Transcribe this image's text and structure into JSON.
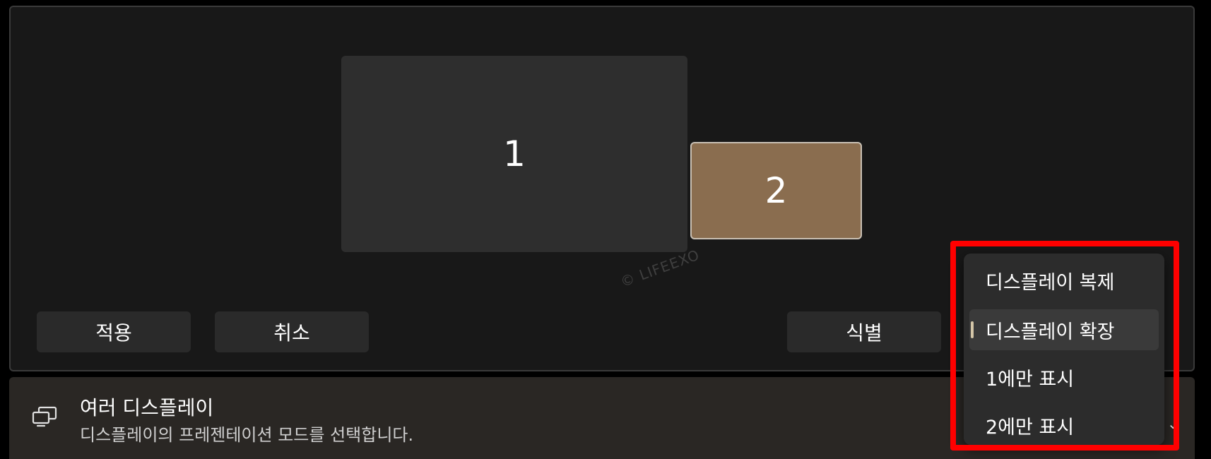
{
  "monitors": [
    {
      "label": "1",
      "selected": false
    },
    {
      "label": "2",
      "selected": true
    }
  ],
  "watermark": "© LIFEEXO",
  "buttons": {
    "apply": "적용",
    "cancel": "취소",
    "identify": "식별"
  },
  "multiple_displays": {
    "title": "여러 디스플레이",
    "description": "디스플레이의 프레젠테이션 모드를 선택합니다.",
    "icon": "multi-display-icon"
  },
  "dropdown": {
    "options": [
      {
        "label": "디스플레이 복제"
      },
      {
        "label": "디스플레이 확장"
      },
      {
        "label": "1에만 표시"
      },
      {
        "label": "2에만 표시"
      }
    ],
    "selected": "디스플레이 확장"
  },
  "colors": {
    "accent": "#8a6d4f",
    "highlight": "#ff0000",
    "selection_indicator": "#d4c6a8"
  }
}
